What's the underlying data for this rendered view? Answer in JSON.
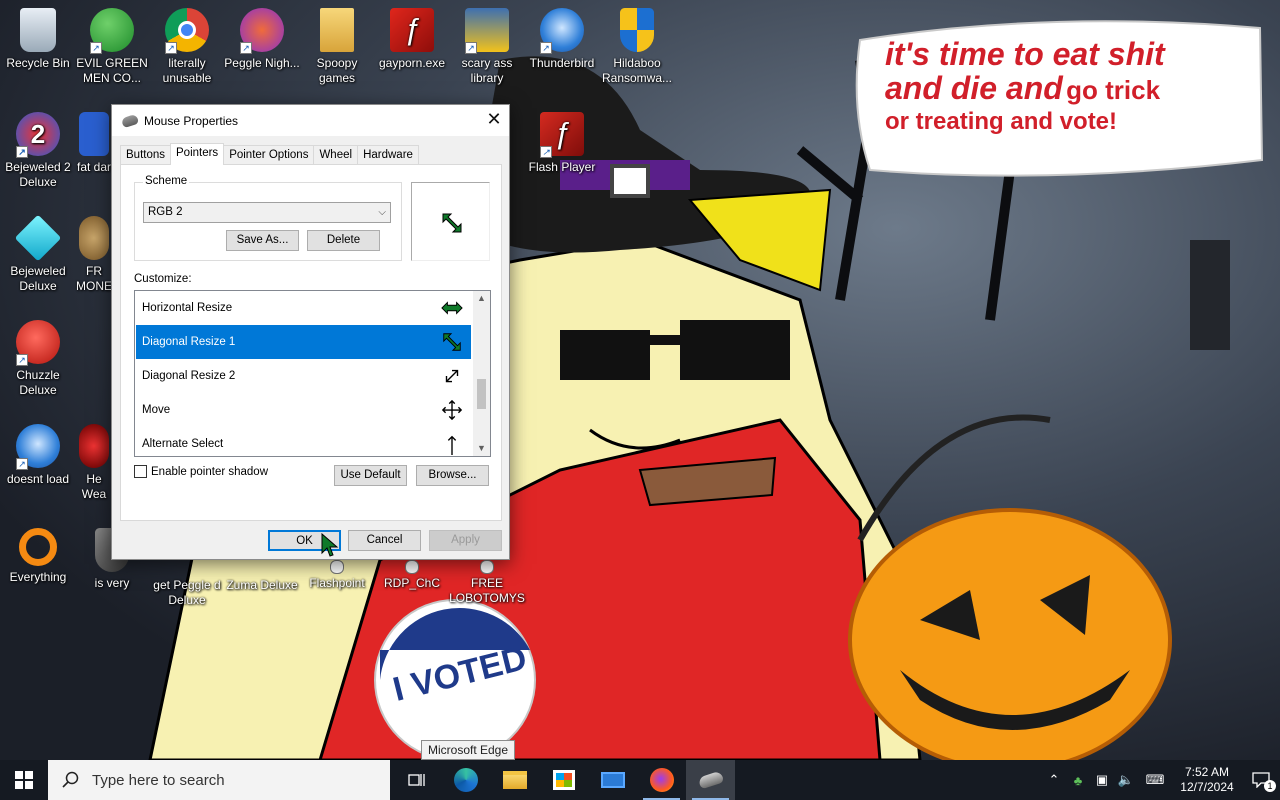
{
  "desktop": {
    "icons": [
      {
        "label": "Recycle Bin",
        "icon": "recycle-bin-icon"
      },
      {
        "label": "EVIL GREEN MEN CO...",
        "icon": "people-icon"
      },
      {
        "label": "literally unusable",
        "icon": "chrome-icon"
      },
      {
        "label": "Peggle Nigh...",
        "icon": "peggle-icon"
      },
      {
        "label": "Spoopy games",
        "icon": "folder-icon"
      },
      {
        "label": "gayporn.exe",
        "icon": "flash-icon"
      },
      {
        "label": "scary ass library",
        "icon": "library-icon"
      },
      {
        "label": "Thunderbird",
        "icon": "thunderbird-icon"
      },
      {
        "label": "Hildaboo Ransomwa...",
        "icon": "shield-icon"
      },
      {
        "label": "Bejeweled 2 Deluxe",
        "icon": "bejeweled2-icon"
      },
      {
        "label": "fat dar",
        "icon": "partial-icon"
      },
      {
        "label": "Flash Player",
        "icon": "flash-icon"
      },
      {
        "label": "Bejeweled Deluxe",
        "icon": "gem-icon"
      },
      {
        "label": "FR MONE",
        "icon": "money-bag-icon"
      },
      {
        "label": "Chuzzle Deluxe",
        "icon": "chuzzle-icon"
      },
      {
        "label": "doesnt load",
        "icon": "thunderbird-icon"
      },
      {
        "label": "He Wea",
        "icon": "partial-icon"
      },
      {
        "label": "Everything",
        "icon": "search-ring-icon"
      },
      {
        "label": "is very",
        "icon": "shield-icon"
      },
      {
        "label": "get Peggle d Deluxe",
        "icon": "peggle-icon"
      },
      {
        "label": "Zuma Deluxe",
        "icon": "zuma-icon"
      },
      {
        "label": "Flashpoint",
        "icon": "flashpoint-icon"
      },
      {
        "label": "RDP_ChC",
        "icon": "rdp-icon"
      },
      {
        "label": "FREE LOBOTOMYS",
        "icon": "gift-icon"
      }
    ],
    "wallpaper_caption": {
      "line1": "it's time to eat shit",
      "line2a": "and die and",
      "line2b": "go trick",
      "line3": "or treating and vote!"
    },
    "sticker_text": "I VOTED",
    "tooltip": "Microsoft Edge"
  },
  "dialog": {
    "title": "Mouse Properties",
    "close": "✕",
    "tabs": [
      "Buttons",
      "Pointers",
      "Pointer Options",
      "Wheel",
      "Hardware"
    ],
    "active_tab": "Pointers",
    "scheme": {
      "group_label": "Scheme",
      "selected": "RGB 2",
      "save_as": "Save As...",
      "delete": "Delete"
    },
    "customize_label": "Customize:",
    "cursor_items": [
      {
        "label": "Horizontal Resize",
        "icon": "horizontal-resize-icon",
        "selected": false
      },
      {
        "label": "Diagonal Resize 1",
        "icon": "diagonal-resize-1-icon",
        "selected": true
      },
      {
        "label": "Diagonal Resize 2",
        "icon": "diagonal-resize-2-icon",
        "selected": false
      },
      {
        "label": "Move",
        "icon": "move-icon",
        "selected": false
      },
      {
        "label": "Alternate Select",
        "icon": "alternate-select-icon",
        "selected": false
      }
    ],
    "enable_shadow_label": "Enable pointer shadow",
    "enable_shadow_checked": false,
    "use_default": "Use Default",
    "browse": "Browse...",
    "ok": "OK",
    "cancel": "Cancel",
    "apply": "Apply"
  },
  "taskbar": {
    "search_placeholder": "Type here to search",
    "apps": [
      "task-view-icon",
      "edge-icon",
      "file-explorer-icon",
      "store-icon",
      "mail-icon",
      "firefox-icon",
      "mouse-icon"
    ],
    "time": "7:52 AM",
    "date": "12/7/2024",
    "notification_count": "1"
  },
  "colors": {
    "accent": "#0078d7",
    "cursor_green": "#0f7a2a",
    "caption_red": "#d11f2a"
  }
}
